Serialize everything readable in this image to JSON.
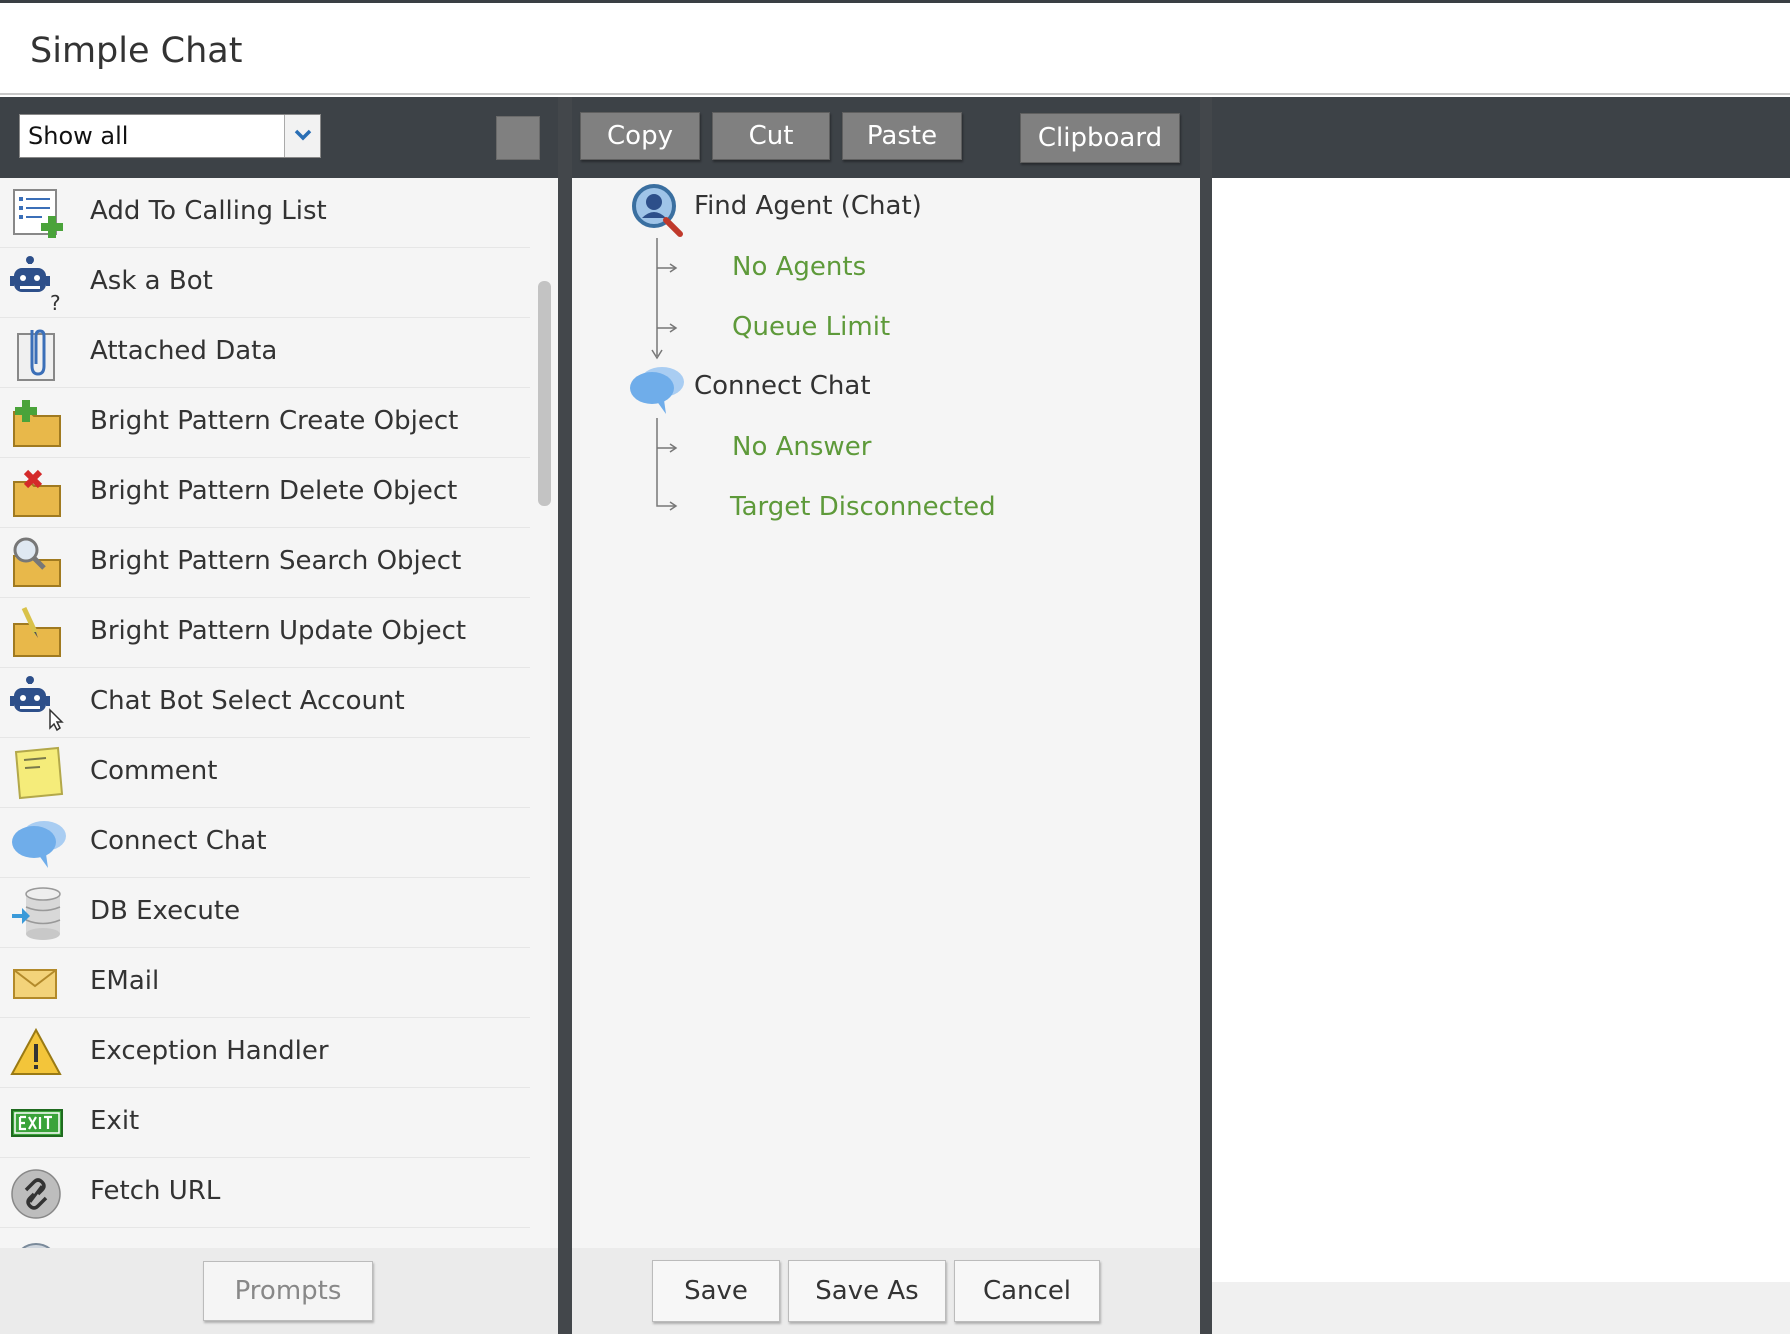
{
  "window": {
    "title": "Simple Chat"
  },
  "palette": {
    "filter": {
      "value": "Show all"
    },
    "items": [
      {
        "label": "Add To Calling List",
        "icon": "calling-list-add-icon"
      },
      {
        "label": "Ask a Bot",
        "icon": "bot-question-icon"
      },
      {
        "label": "Attached Data",
        "icon": "attached-data-icon"
      },
      {
        "label": "Bright Pattern Create Object",
        "icon": "folder-create-icon"
      },
      {
        "label": "Bright Pattern Delete Object",
        "icon": "folder-delete-icon"
      },
      {
        "label": "Bright Pattern Search Object",
        "icon": "folder-search-icon"
      },
      {
        "label": "Bright Pattern Update Object",
        "icon": "folder-update-icon"
      },
      {
        "label": "Chat Bot Select Account",
        "icon": "bot-select-icon"
      },
      {
        "label": "Comment",
        "icon": "comment-note-icon"
      },
      {
        "label": "Connect Chat",
        "icon": "chat-bubbles-icon"
      },
      {
        "label": "DB Execute",
        "icon": "database-icon"
      },
      {
        "label": "EMail",
        "icon": "email-envelope-icon"
      },
      {
        "label": "Exception Handler",
        "icon": "warning-icon"
      },
      {
        "label": "Exit",
        "icon": "exit-sign-icon"
      },
      {
        "label": "Fetch URL",
        "icon": "link-icon"
      }
    ],
    "footer": {
      "prompts_label": "Prompts"
    }
  },
  "editor": {
    "toolbar": {
      "copy_label": "Copy",
      "cut_label": "Cut",
      "paste_label": "Paste",
      "clipboard_label": "Clipboard"
    },
    "flow": [
      {
        "label": "Find Agent (Chat)",
        "icon": "find-agent-icon",
        "branches": [
          "No Agents",
          "Queue Limit"
        ]
      },
      {
        "label": "Connect Chat",
        "icon": "chat-bubbles-icon",
        "branches": [
          "No Answer",
          "Target Disconnected"
        ]
      }
    ],
    "footer": {
      "save_label": "Save",
      "save_as_label": "Save As",
      "cancel_label": "Cancel"
    }
  },
  "colors": {
    "toolbar_bg": "#3d4247",
    "button_gray": "#808080",
    "branch_green": "#5e9a3a",
    "panel_bg": "#f5f5f5"
  }
}
